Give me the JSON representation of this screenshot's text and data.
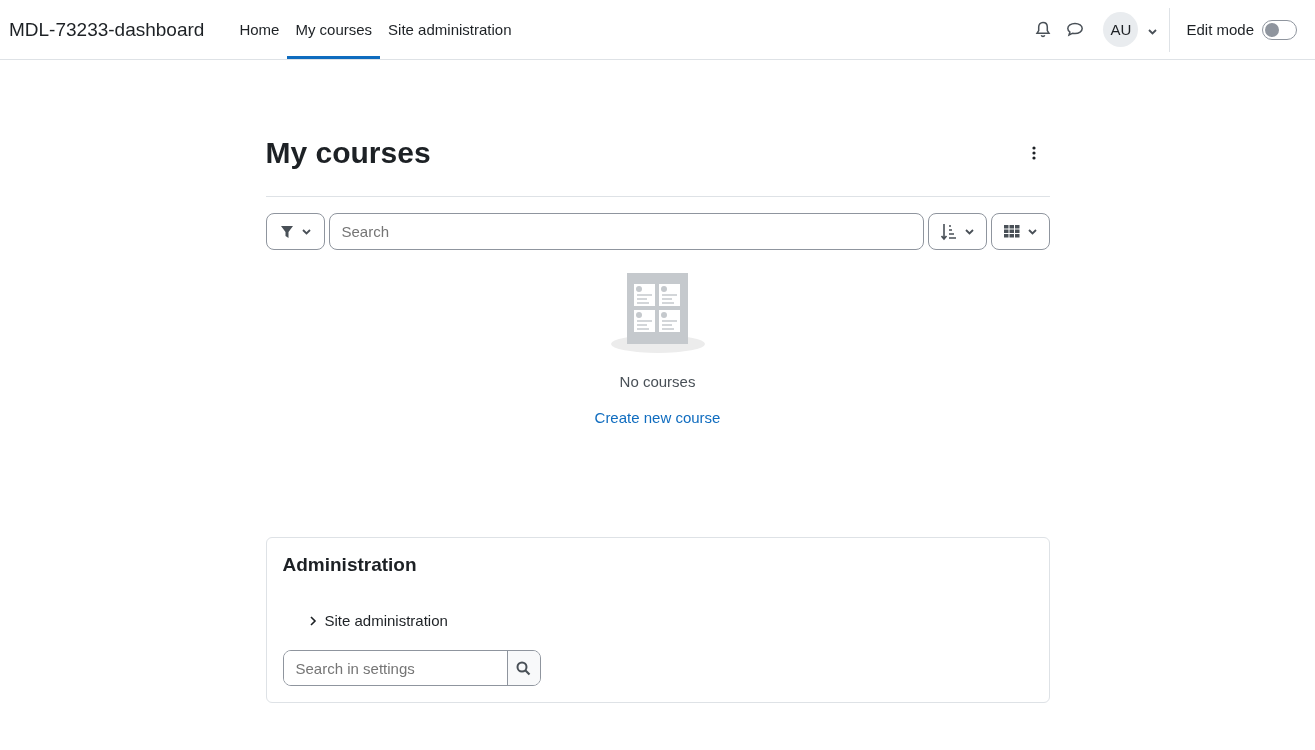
{
  "navbar": {
    "brand": "MDL-73233-dashboard",
    "links": [
      {
        "label": "Home",
        "selected": false
      },
      {
        "label": "My courses",
        "selected": true
      },
      {
        "label": "Site administration",
        "selected": false
      }
    ],
    "avatar": "AU",
    "edit_mode": {
      "label": "Edit mode",
      "on": false
    }
  },
  "page": {
    "title": "My courses",
    "search": {
      "placeholder": "Search"
    },
    "empty_message": "No courses",
    "create_link": "Create new course"
  },
  "admin_block": {
    "title": "Administration",
    "tree": [
      {
        "label": "Site administration",
        "expanded": false
      }
    ],
    "search": {
      "placeholder": "Search in settings"
    }
  }
}
